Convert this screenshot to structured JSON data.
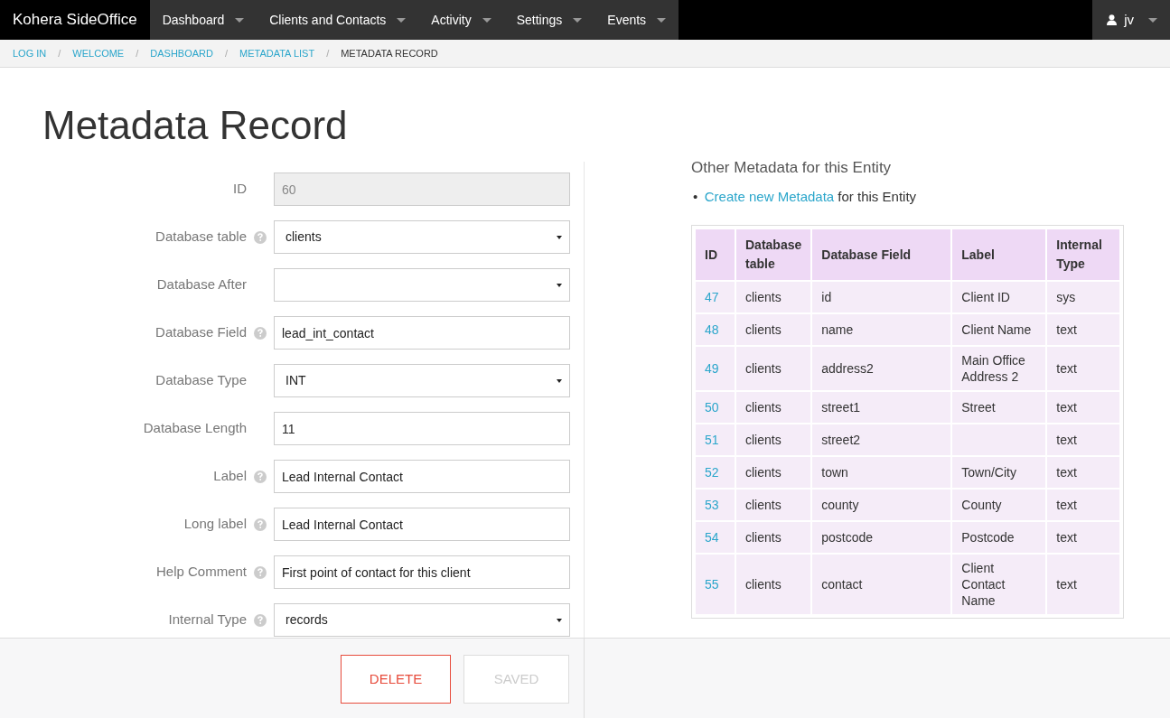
{
  "navbar": {
    "brand": "Kohera SideOffice",
    "menus": [
      {
        "label": "Dashboard"
      },
      {
        "label": "Clients and Contacts"
      },
      {
        "label": "Activity"
      },
      {
        "label": "Settings"
      },
      {
        "label": "Events"
      }
    ],
    "user": "jv"
  },
  "breadcrumb_separator": "/",
  "breadcrumb": [
    {
      "label": "LOG IN",
      "selected": false
    },
    {
      "label": "WELCOME",
      "selected": false
    },
    {
      "label": "DASHBOARD",
      "selected": false
    },
    {
      "label": "METADATA LIST",
      "selected": false
    },
    {
      "label": "METADATA RECORD",
      "selected": true
    }
  ],
  "title": "Metadata Record",
  "form": [
    {
      "label": "ID",
      "help": false,
      "kind": "readonly",
      "value": "60"
    },
    {
      "label": "Database table",
      "help": true,
      "kind": "select",
      "value": "clients"
    },
    {
      "label": "Database After",
      "help": false,
      "kind": "select"
    },
    {
      "label": "Database Field",
      "help": true,
      "kind": "text",
      "value": "lead_int_contact"
    },
    {
      "label": "Database Type",
      "help": false,
      "kind": "select",
      "value": "INT"
    },
    {
      "label": "Database Length",
      "help": false,
      "kind": "text",
      "value": "11"
    },
    {
      "label": "Label",
      "help": true,
      "kind": "text",
      "value": "Lead Internal Contact"
    },
    {
      "label": "Long label",
      "help": true,
      "kind": "text",
      "value": "Lead Internal Contact"
    },
    {
      "label": "Help Comment",
      "help": true,
      "kind": "text",
      "value": "First point of contact for this client"
    },
    {
      "label": "Internal Type",
      "help": true,
      "kind": "select",
      "value": "records"
    }
  ],
  "buttons": [
    {
      "label": "DELETE",
      "kind": "danger"
    },
    {
      "label": "SAVED",
      "kind": "save",
      "disabled": true
    }
  ],
  "side": {
    "bullet": "•",
    "heading": "Other Metadata for this Entity",
    "link": "Create new Metadata",
    "link_rest": " for this Entity"
  },
  "table": {
    "columns": [
      "ID",
      "Database table",
      "Database Field",
      "Label",
      "Internal Type"
    ],
    "rows": [
      [
        "47",
        "clients",
        "id",
        "Client ID",
        "sys"
      ],
      [
        "48",
        "clients",
        "name",
        "Client Name",
        "text"
      ],
      [
        "49",
        "clients",
        "address2",
        "Main Office Address 2",
        "text"
      ],
      [
        "50",
        "clients",
        "street1",
        "Street",
        "text"
      ],
      [
        "51",
        "clients",
        "street2",
        "",
        "text"
      ],
      [
        "52",
        "clients",
        "town",
        "Town/City",
        "text"
      ],
      [
        "53",
        "clients",
        "county",
        "County",
        "text"
      ],
      [
        "54",
        "clients",
        "postcode",
        "Postcode",
        "text"
      ],
      [
        "55",
        "clients",
        "contact",
        "Client Contact Name",
        "text"
      ]
    ]
  }
}
